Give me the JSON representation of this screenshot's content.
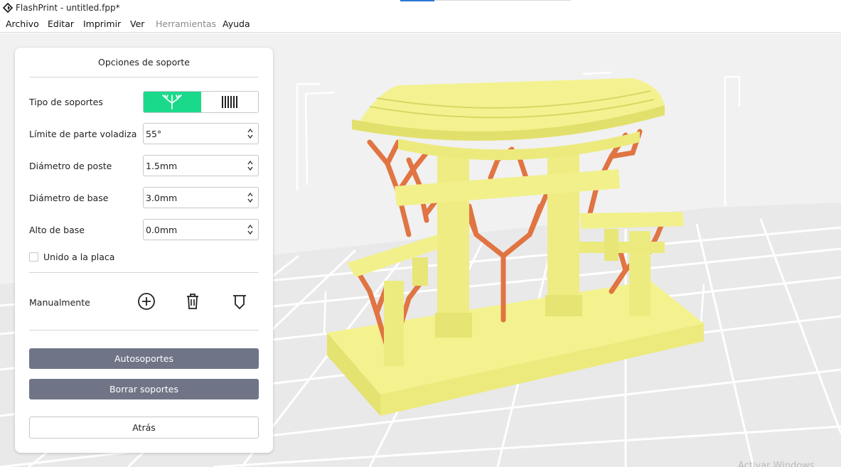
{
  "window": {
    "title": "FlashPrint - untitled.fpp*"
  },
  "menu": [
    "Archivo",
    "Editar",
    "Imprimir",
    "Ver",
    "Herramientas",
    "Ayuda"
  ],
  "panel": {
    "title": "Opciones de soporte",
    "support_type": {
      "label": "Tipo de soportes",
      "selected": "tree",
      "options": [
        "tree-icon",
        "linear-icon"
      ]
    },
    "overhang": {
      "label": "Límite de parte voladiza",
      "value": "55°"
    },
    "post_diameter": {
      "label": "Diámetro de poste",
      "value": "1.5mm"
    },
    "base_diameter": {
      "label": "Diámetro de base",
      "value": "3.0mm"
    },
    "base_height": {
      "label": "Alto de base",
      "value": "0.0mm"
    },
    "attach_plate": {
      "label": "Unido a la placa",
      "checked": false
    },
    "manual": {
      "label": "Manualmente",
      "icons": [
        "add-support-icon",
        "delete-support-icon",
        "platform-support-icon"
      ]
    },
    "auto_button": "Autosoportes",
    "clear_button": "Borrar soportes",
    "back_button": "Atrás"
  },
  "watermark": "Activar Windows",
  "colors": {
    "accent": "#1bd98a",
    "button": "#6f7587",
    "model": "#f2f08a",
    "support": "#e07442"
  }
}
